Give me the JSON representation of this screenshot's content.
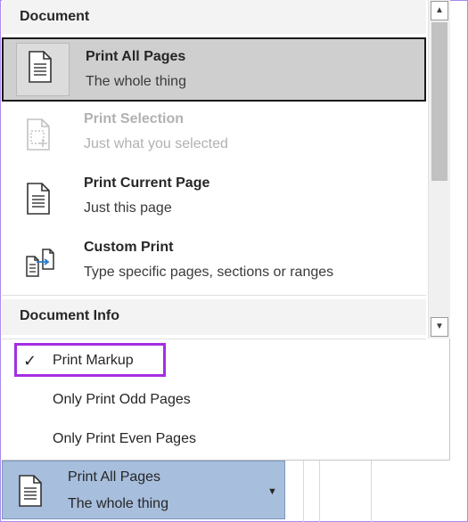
{
  "sections": {
    "document": "Document",
    "document_info": "Document Info"
  },
  "items": [
    {
      "title": "Print All Pages",
      "subtitle": "The whole thing",
      "icon": "page-icon",
      "state": "selected"
    },
    {
      "title": "Print Selection",
      "subtitle": "Just what you selected",
      "icon": "selection-page-icon",
      "state": "disabled"
    },
    {
      "title": "Print Current Page",
      "subtitle": "Just this page",
      "icon": "page-icon",
      "state": "normal"
    },
    {
      "title": "Custom Print",
      "subtitle": "Type specific pages, sections or ranges",
      "icon": "custom-print-icon",
      "state": "normal"
    }
  ],
  "options": [
    {
      "label": "Print Markup",
      "checked": true
    },
    {
      "label": "Only Print Odd Pages",
      "checked": false
    },
    {
      "label": "Only Print Even Pages",
      "checked": false
    }
  ],
  "check_mark": "✓",
  "scroll": {
    "up": "▲",
    "down": "▼"
  },
  "bottom_button": {
    "title": "Print All Pages",
    "subtitle": "The whole thing",
    "caret": "▼"
  },
  "colors": {
    "highlight_outline": "#a42ee3",
    "selected_bg": "#cfcfcf",
    "bottom_button_bg": "#a7bedd",
    "frame": "#a78bf0"
  }
}
